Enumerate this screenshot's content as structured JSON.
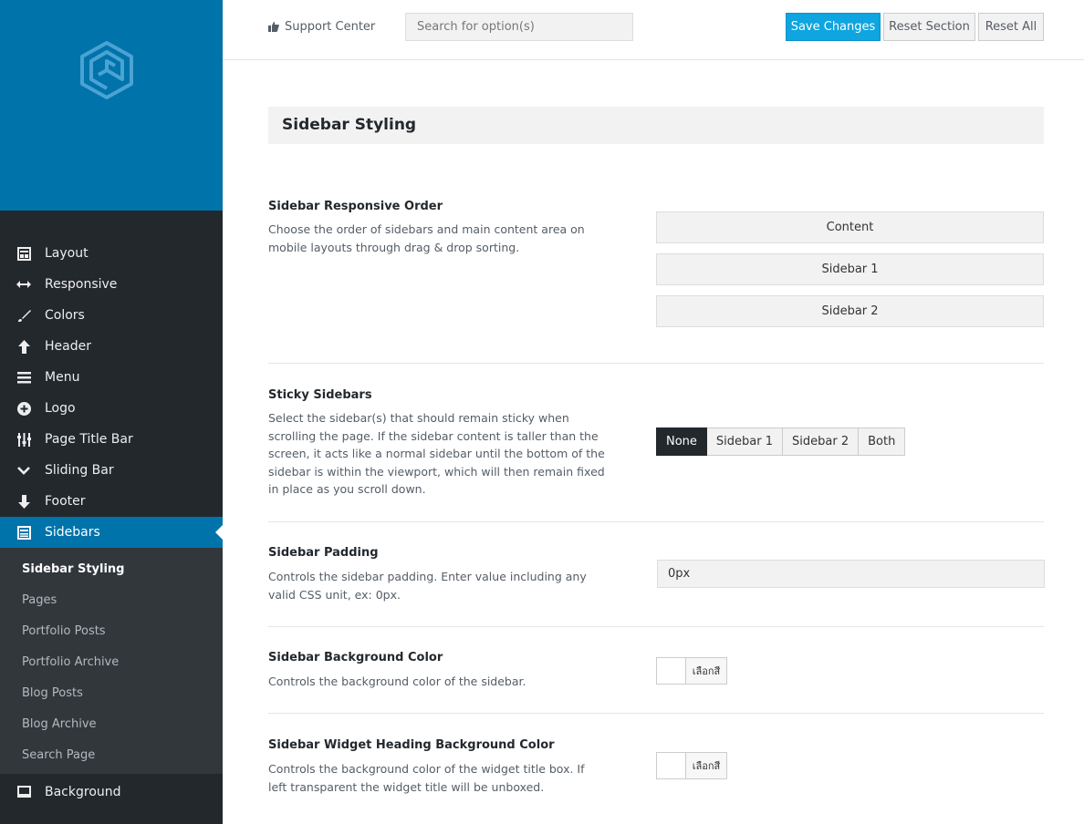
{
  "colors": {
    "brand_blue": "#0073aa",
    "sidebar_bg": "#23282d",
    "submenu_bg": "#32373c",
    "save_button": "#0ea5e0"
  },
  "logo": {
    "icon": "hexagon-spiral-logo"
  },
  "sidebar": {
    "items": [
      {
        "label": "Layout",
        "icon": "layout-icon"
      },
      {
        "label": "Responsive",
        "icon": "arrows-horizontal-icon"
      },
      {
        "label": "Colors",
        "icon": "brush-icon"
      },
      {
        "label": "Header",
        "icon": "arrow-up-icon"
      },
      {
        "label": "Menu",
        "icon": "menu-icon"
      },
      {
        "label": "Logo",
        "icon": "plus-circle-icon"
      },
      {
        "label": "Page Title Bar",
        "icon": "sliders-icon"
      },
      {
        "label": "Sliding Bar",
        "icon": "chevron-down-icon"
      },
      {
        "label": "Footer",
        "icon": "arrow-down-icon"
      },
      {
        "label": "Sidebars",
        "icon": "sidebar-layout-icon"
      }
    ],
    "subitems": [
      {
        "label": "Sidebar Styling"
      },
      {
        "label": "Pages"
      },
      {
        "label": "Portfolio Posts"
      },
      {
        "label": "Portfolio Archive"
      },
      {
        "label": "Blog Posts"
      },
      {
        "label": "Blog Archive"
      },
      {
        "label": "Search Page"
      }
    ],
    "bottom_item": {
      "label": "Background",
      "icon": "monitor-icon"
    }
  },
  "topbar": {
    "support_label": "Support Center",
    "search_placeholder": "Search for option(s)",
    "save_label": "Save Changes",
    "reset_section_label": "Reset Section",
    "reset_all_label": "Reset All"
  },
  "main": {
    "section_title": "Sidebar Styling",
    "fields": {
      "order": {
        "label": "Sidebar Responsive Order",
        "desc": "Choose the order of sidebars and main content area on mobile layouts through drag & drop sorting.",
        "items": [
          "Content",
          "Sidebar 1",
          "Sidebar 2"
        ]
      },
      "sticky": {
        "label": "Sticky Sidebars",
        "desc": "Select the sidebar(s) that should remain sticky when scrolling the page. If the sidebar content is taller than the screen, it acts like a normal sidebar until the bottom of the sidebar is within the viewport, which will then remain fixed in place as you scroll down.",
        "options": [
          "None",
          "Sidebar 1",
          "Sidebar 2",
          "Both"
        ],
        "selected": "None"
      },
      "padding": {
        "label": "Sidebar Padding",
        "desc": "Controls the sidebar padding. Enter value including any valid CSS unit, ex: 0px.",
        "value": "0px"
      },
      "bg_color": {
        "label": "Sidebar Background Color",
        "desc": "Controls the background color of the sidebar.",
        "button_label": "เลือกสี"
      },
      "widget_bg_color": {
        "label": "Sidebar Widget Heading Background Color",
        "desc": "Controls the background color of the widget title box. If left transparent the widget title will be unboxed.",
        "button_label": "เลือกสี"
      }
    }
  }
}
